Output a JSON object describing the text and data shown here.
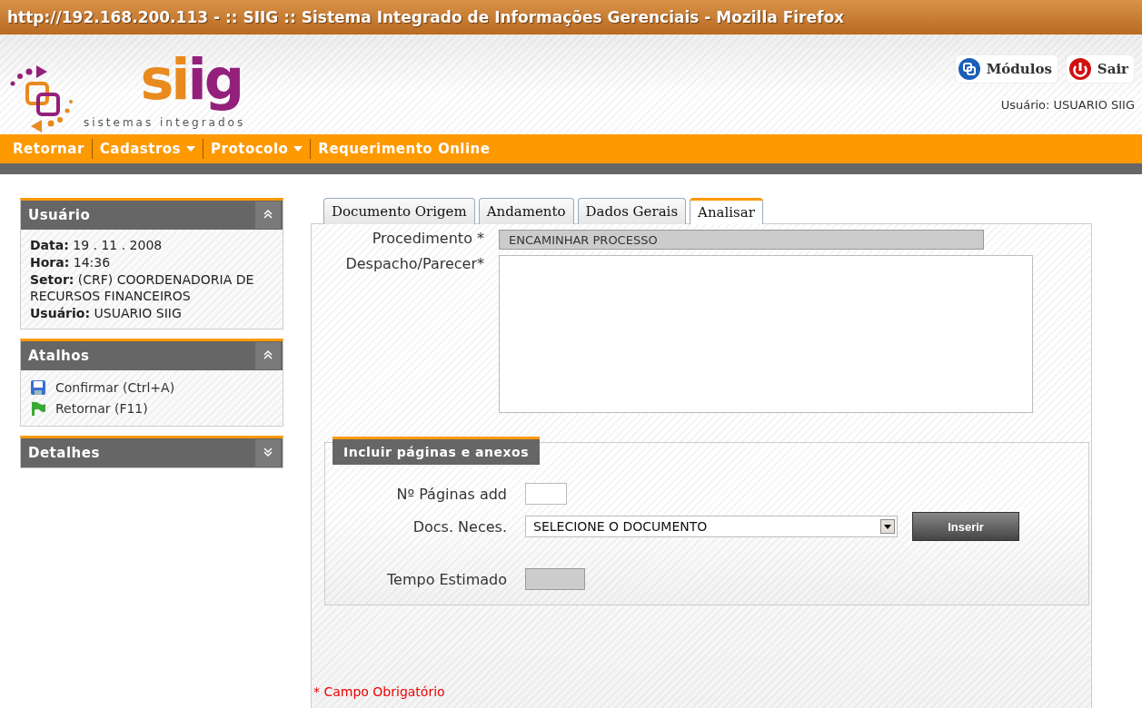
{
  "window": {
    "title": "http://192.168.200.113 - :: SIIG :: Sistema Integrado de Informações Gerenciais - Mozilla Firefox"
  },
  "logo": {
    "wordmark": "siig",
    "tagline": "sistemas integrados"
  },
  "header_buttons": [
    {
      "kind": "modules",
      "label": "Módulos"
    },
    {
      "kind": "exit",
      "label": "Sair"
    }
  ],
  "user_line": "Usuário: USUARIO SIIG",
  "menu": [
    {
      "label": "Retornar",
      "dropdown": false
    },
    {
      "label": "Cadastros",
      "dropdown": true
    },
    {
      "label": "Protocolo",
      "dropdown": true
    },
    {
      "label": "Requerimento Online",
      "dropdown": false
    }
  ],
  "sidebar": [
    {
      "title": "Usuário",
      "expanded": true,
      "kind": "info",
      "lines": [
        "**Data:** 19 . 11 . 2008",
        "**Hora:** 14:36",
        "**Setor:** (CRF) COORDENADORIA DE RECURSOS FINANCEIROS",
        "**Usuário:** USUARIO SIIG"
      ]
    },
    {
      "title": "Atalhos",
      "expanded": true,
      "kind": "links",
      "links": [
        {
          "kind": "confirm",
          "label": "Confirmar (Ctrl+A)"
        },
        {
          "kind": "return",
          "label": "Retornar (F11)"
        }
      ]
    },
    {
      "title": "Detalhes",
      "expanded": false
    }
  ],
  "tabs": [
    {
      "label": "Documento Origem",
      "selected": false
    },
    {
      "label": "Andamento",
      "selected": false
    },
    {
      "label": "Dados Gerais",
      "selected": false
    },
    {
      "label": "Analisar",
      "selected": true
    }
  ],
  "form": {
    "procedimento": {
      "label": "Procedimento *",
      "value": "ENCAMINHAR PROCESSO"
    },
    "despacho": {
      "label": "Despacho/Parecer*"
    }
  },
  "attachments": {
    "title": "Incluir páginas e anexos",
    "paginas": {
      "label": "Nº Páginas add"
    },
    "docs": {
      "label": "Docs. Neces.",
      "value": "SELECIONE O DOCUMENTO"
    },
    "button": "Inserir",
    "tempo": {
      "label": "Tempo Estimado"
    }
  },
  "required_note": "* Campo Obrigatório"
}
